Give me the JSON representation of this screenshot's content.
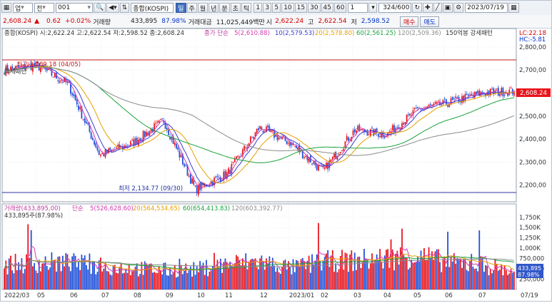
{
  "toolbar": {
    "menu_label": "업",
    "market_select": "전",
    "code_value": "001",
    "index_name": "종합(KOSPI)",
    "periods": [
      "일",
      "주",
      "월",
      "년",
      "분",
      "초",
      "틱"
    ],
    "active_period": "일",
    "minutes": [
      "1",
      "3",
      "5",
      "10",
      "15",
      "30",
      "45",
      "60"
    ],
    "unit_value": "1",
    "count_value": "324/600",
    "date_value": "2023/07/19",
    "buy_label": "매수",
    "sell_label": "매도"
  },
  "infobar": {
    "price": "2,608.24",
    "arrow": "▲",
    "change": "0.62",
    "change_pct": "+0.02%",
    "volume_label": "거래량",
    "volume": "433,895",
    "volume_ratio": "87.98%",
    "amount_label": "거래대금",
    "amount": "11,025,449백만",
    "open_label": "시",
    "open": "2,622.24",
    "high_label": "고",
    "high": "2,622.54",
    "low_label": "저",
    "low": "2,598.52"
  },
  "price_panel": {
    "header_left": "종합(KOSPI) 시:2,622.24 고:2,622.54 저:2,598.52 종:2,608.24",
    "ma_label": "종가 단순",
    "ma5": "5(2,610.88)",
    "ma10": "10(2,579.53)",
    "ma20": "20(2,578.80)",
    "ma60": "60(2,561.25)",
    "ma120": "120(2,509.36)",
    "pattern": "150억봉 강세패턴",
    "pattern2": "약세패턴",
    "lc": "LC:22.18",
    "hc": "HC:-5.81",
    "high_marker": "최고 2,769.18 (04/05)",
    "low_marker": "최저 2,134.77 (09/30)",
    "current_tag": "2,608.24",
    "y_ticks": [
      "2,800,00",
      "2,700,00",
      "2,600,00",
      "2,500,00",
      "2,400,00",
      "2,300,00",
      "2,200,00"
    ]
  },
  "volume_panel": {
    "header": "거래량(433,895,00)",
    "ma_label": "단순",
    "ma5": "5(526,628.60)",
    "ma20": "20(564,534.65)",
    "ma60": "60(654,413.83)",
    "ma120": "120(603,392.77)",
    "current_label": "433,895주(87.98%)",
    "tag_value": "433,895",
    "tag_pct": "87.98%",
    "y_ticks": [
      "1,750K",
      "1,500K",
      "1,250K",
      "1,000K",
      "750,000",
      "500,000",
      "250,000"
    ]
  },
  "x_axis": {
    "labels": [
      "2022/03",
      "05",
      "06",
      "07",
      "08",
      "09",
      "10",
      "11",
      "12",
      "2023/01",
      "02",
      "03",
      "04",
      "05",
      "06",
      "07"
    ],
    "corner": "07/19"
  },
  "colors": {
    "up": "#e8141c",
    "down": "#1f4fd8",
    "ma5": "#d43bb0",
    "ma10": "#3b3bd4",
    "ma20": "#e5a000",
    "ma60": "#1aa33a",
    "ma120": "#8a8a8a",
    "hline": "#c21818",
    "lowline": "#3030a0"
  },
  "chart_data": {
    "type": "candlestick",
    "x": [
      "2022/03",
      "05",
      "06",
      "07",
      "08",
      "09",
      "10",
      "11",
      "12",
      "2023/01",
      "02",
      "03",
      "04",
      "05",
      "06",
      "07"
    ],
    "price_ylim": [
      2140,
      2840
    ],
    "price_close_approx": [
      2700,
      2720,
      2640,
      2330,
      2380,
      2480,
      2180,
      2250,
      2450,
      2380,
      2260,
      2440,
      2420,
      2530,
      2560,
      2600,
      2608.24
    ],
    "volume_ylim": [
      0,
      1850000
    ],
    "volume_approx_k": [
      600,
      650,
      650,
      560,
      520,
      470,
      480,
      620,
      680,
      520,
      680,
      700,
      760,
      820,
      640,
      600,
      434
    ]
  }
}
